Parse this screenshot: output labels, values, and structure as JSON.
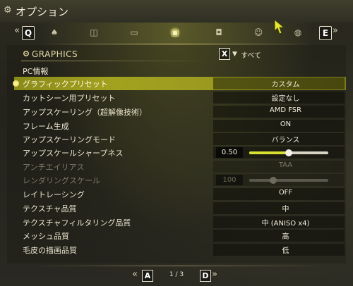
{
  "window": {
    "title": "オプション"
  },
  "tabs": {
    "prev_key": "Q",
    "next_key": "E",
    "items": [
      {
        "icon": "character-icon"
      },
      {
        "icon": "gamepad-icon"
      },
      {
        "icon": "display-icon"
      },
      {
        "icon": "graphics-image-icon",
        "active": true
      },
      {
        "icon": "speaker-icon"
      },
      {
        "icon": "accessibility-icon"
      },
      {
        "icon": "network-globe-icon"
      }
    ]
  },
  "section": {
    "title": "GRAPHICS",
    "filter_key": "X",
    "filter_label": "すべて",
    "subheading": "PC情報"
  },
  "settings": [
    {
      "label": "グラフィックプリセット",
      "value": "カスタム",
      "selected": true
    },
    {
      "label": "カットシーン用プリセット",
      "value": "設定なし"
    },
    {
      "label": "アップスケーリング（超解像技術）",
      "value": "AMD FSR"
    },
    {
      "label": "フレーム生成",
      "value": "ON"
    },
    {
      "label": "アップスケーリングモード",
      "value": "バランス"
    },
    {
      "label": "アップスケールシャープネス",
      "value": "0.50",
      "slider": 0.5
    },
    {
      "label": "アンチエイリアス",
      "value": "TAA",
      "disabled": true
    },
    {
      "label": "レンダリングスケール",
      "value": "100",
      "slider": 0.3,
      "disabled": true
    },
    {
      "label": "レイトレーシング",
      "value": "OFF"
    },
    {
      "label": "テクスチャ品質",
      "value": "中"
    },
    {
      "label": "テクスチャフィルタリング品質",
      "value": "中 (ANISO x4)"
    },
    {
      "label": "メッシュ品質",
      "value": "高"
    },
    {
      "label": "毛皮の描画品質",
      "value": "低"
    }
  ],
  "pager": {
    "prev_key": "A",
    "next_key": "D",
    "text": "1 / 3"
  },
  "colors": {
    "highlight": "#9a9a20",
    "slider_fill": "#d8e030"
  }
}
